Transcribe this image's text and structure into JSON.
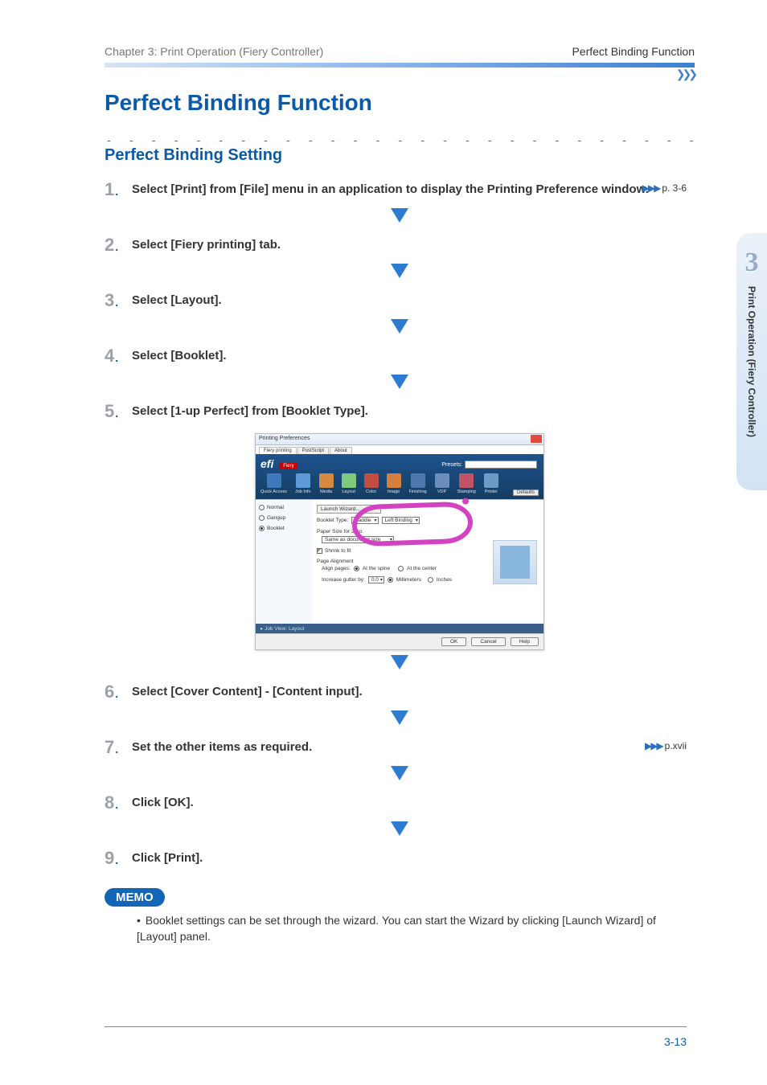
{
  "header": {
    "left": "Chapter 3: Print Operation (Fiery Controller)",
    "right": "Perfect Binding Function"
  },
  "title": "Perfect Binding Function",
  "subtitle": "Perfect Binding Setting",
  "steps": [
    {
      "num": "1",
      "text": "Select [Print] from [File] menu in an application to display the Printing Preference window.",
      "ref": "p. 3-6"
    },
    {
      "num": "2",
      "text": "Select [Fiery printing] tab."
    },
    {
      "num": "3",
      "text": "Select [Layout]."
    },
    {
      "num": "4",
      "text": "Select [Booklet]."
    },
    {
      "num": "5",
      "text": "Select [1-up Perfect] from [Booklet Type]."
    },
    {
      "num": "6",
      "text": "Select [Cover Content] - [Content input]."
    },
    {
      "num": "7",
      "text": "Set the other items as required.",
      "ref": "p.xvii"
    },
    {
      "num": "8",
      "text": "Click [OK]."
    },
    {
      "num": "9",
      "text": "Click [Print]."
    }
  ],
  "screenshot": {
    "window_title": "Printing Preferences",
    "tabs": [
      "Fiery printing",
      "PostScript",
      "About"
    ],
    "logo": "efi",
    "fiery_badge": "Fiery",
    "presets_label": "Presets:",
    "ribbon": [
      "Quick Access",
      "Job Info",
      "Media",
      "Layout",
      "Color",
      "Image",
      "Finishing",
      "VDP",
      "Stamping",
      "Printer"
    ],
    "defaults": "Defaults",
    "radios": [
      "Normal",
      "Gangup",
      "Booklet"
    ],
    "launch": "Launch Wizard...",
    "booklet_type_label": "Booklet Type:",
    "booklet_type_value": "Saddle",
    "binding_value": "Left Binding",
    "paper_size_label": "Paper Size for 2-up:",
    "paper_size_value": "Same as document size",
    "shrink": "Shrink to fit",
    "page_align_label": "Page Alignment",
    "align_pages": "Align pages:",
    "align_opt1": "At the spine",
    "align_opt2": "At the center",
    "gutter_label": "Increase gutter by:",
    "gutter_value": "0.0",
    "gutter_unit1": "Millimeters",
    "gutter_unit2": "Inches",
    "bottombar": "▸ Job View: Layout",
    "buttons": [
      "OK",
      "Cancel",
      "Help"
    ]
  },
  "memo": {
    "label": "MEMO",
    "text": "Booklet settings can be set through the wizard. You can start the Wizard by clicking [Launch Wizard] of [Layout] panel."
  },
  "side": {
    "num": "3",
    "text": "Print Operation (Fiery Controller)"
  },
  "page_number": "3-13"
}
